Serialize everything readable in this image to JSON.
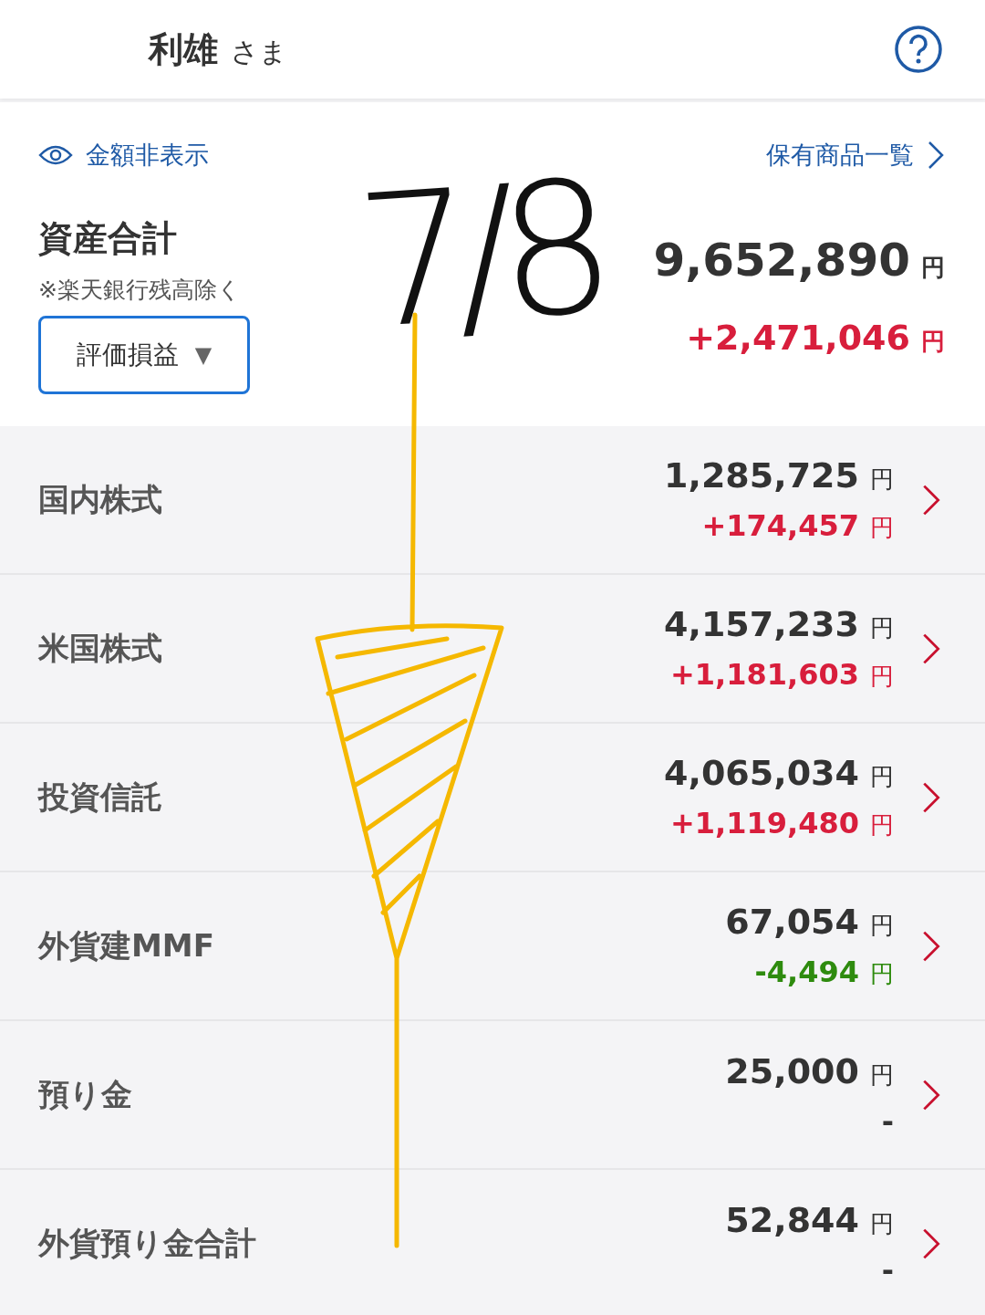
{
  "header": {
    "name": "利雄",
    "honorific": "さま"
  },
  "summary": {
    "hide_link": "金額非表示",
    "holdings_link": "保有商品一覧",
    "title": "資産合計",
    "note": "※楽天銀行残高除く",
    "dropdown": "評価損益",
    "dropdown_caret": "▼",
    "total": "9,652,890",
    "total_unit": "円",
    "change": "+2,471,046",
    "change_unit": "円",
    "color": "#d81e3c"
  },
  "rows": [
    {
      "label": "国内株式",
      "amount": "1,285,725",
      "amount_unit": "円",
      "change": "+174,457",
      "change_unit": "円",
      "color": "#d81e3c"
    },
    {
      "label": "米国株式",
      "amount": "4,157,233",
      "amount_unit": "円",
      "change": "+1,181,603",
      "change_unit": "円",
      "color": "#d81e3c"
    },
    {
      "label": "投資信託",
      "amount": "4,065,034",
      "amount_unit": "円",
      "change": "+1,119,480",
      "change_unit": "円",
      "color": "#d81e3c"
    },
    {
      "label": "外貨建MMF",
      "amount": "67,054",
      "amount_unit": "円",
      "change": "-4,494",
      "change_unit": "円",
      "color": "#2e8b0e"
    },
    {
      "label": "預り金",
      "amount": "25,000",
      "amount_unit": "円",
      "change": "-",
      "color": "#333333"
    },
    {
      "label": "外貨預り金合計",
      "amount": "52,844",
      "amount_unit": "円",
      "change": "-",
      "color": "#333333"
    }
  ],
  "annotation": {
    "text": "7/8"
  }
}
